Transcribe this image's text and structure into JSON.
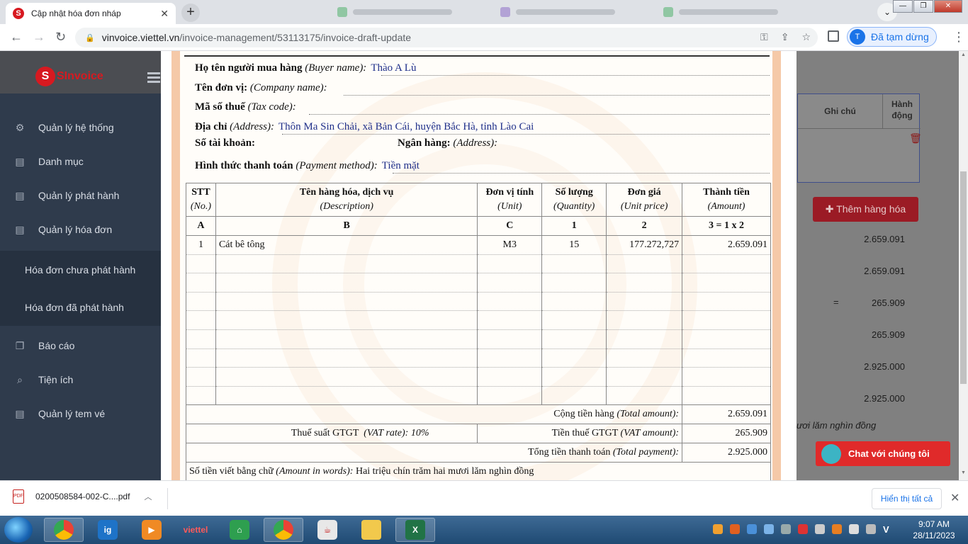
{
  "browser": {
    "tab_title": "Cập nhật hóa đơn nháp",
    "url_host": "vinvoice.viettel.vn",
    "url_path": "/invoice-management/53113175/invoice-draft-update",
    "profile_initial": "T",
    "profile_label": "Đã tạm dừng"
  },
  "sidebar": {
    "logo": "SInvoice",
    "items": [
      {
        "label": "Quản lý hệ thống",
        "icon": "gear-icon"
      },
      {
        "label": "Danh mục",
        "icon": "list-icon"
      },
      {
        "label": "Quản lý phát hành",
        "icon": "list-icon"
      },
      {
        "label": "Quản lý hóa đơn",
        "icon": "list-icon"
      },
      {
        "label": "Hóa đơn chưa phát hành",
        "icon": ""
      },
      {
        "label": "Hóa đơn đã phát hành",
        "icon": ""
      },
      {
        "label": "Báo cáo",
        "icon": "copy-icon"
      },
      {
        "label": "Tiện ích",
        "icon": "search-icon"
      },
      {
        "label": "Quản lý tem vé",
        "icon": "list-icon"
      }
    ]
  },
  "invoice": {
    "buyer_name_label": "Họ tên người mua hàng",
    "buyer_name_en": "(Buyer name):",
    "buyer_name": "Thào A Lù",
    "company_label": "Tên đơn vị:",
    "company_en": "(Company name):",
    "tax_label": "Mã số thuế",
    "tax_en": "(Tax code):",
    "address_label": "Địa chỉ",
    "address_en": "(Address):",
    "address": "Thôn Ma Sin Chải, xã Bản Cái, huyện Bắc Hà, tỉnh Lào Cai",
    "account_label": "Số tài khoản:",
    "bank_label": "Ngân hàng:",
    "bank_en": "(Address):",
    "payment_label": "Hình thức thanh toán",
    "payment_en": "(Payment method):",
    "payment": "Tiền mặt",
    "table_headers": [
      {
        "vi": "STT",
        "en": "(No.)",
        "code": "A"
      },
      {
        "vi": "Tên hàng hóa, dịch vụ",
        "en": "(Description)",
        "code": "B"
      },
      {
        "vi": "Đơn vị tính",
        "en": "(Unit)",
        "code": "C"
      },
      {
        "vi": "Số lượng",
        "en": "(Quantity)",
        "code": "1"
      },
      {
        "vi": "Đơn giá",
        "en": "(Unit price)",
        "code": "2"
      },
      {
        "vi": "Thành tiền",
        "en": "(Amount)",
        "code": "3 = 1 x 2"
      }
    ],
    "rows": [
      {
        "no": "1",
        "desc": "Cát bê tông",
        "unit": "M3",
        "qty": "15",
        "price": "177.272,727",
        "amount": "2.659.091"
      },
      {
        "no": "",
        "desc": "",
        "unit": "",
        "qty": "",
        "price": "",
        "amount": ""
      },
      {
        "no": "",
        "desc": "",
        "unit": "",
        "qty": "",
        "price": "",
        "amount": ""
      },
      {
        "no": "",
        "desc": "",
        "unit": "",
        "qty": "",
        "price": "",
        "amount": ""
      },
      {
        "no": "",
        "desc": "",
        "unit": "",
        "qty": "",
        "price": "",
        "amount": ""
      },
      {
        "no": "",
        "desc": "",
        "unit": "",
        "qty": "",
        "price": "",
        "amount": ""
      },
      {
        "no": "",
        "desc": "",
        "unit": "",
        "qty": "",
        "price": "",
        "amount": ""
      },
      {
        "no": "",
        "desc": "",
        "unit": "",
        "qty": "",
        "price": "",
        "amount": ""
      },
      {
        "no": "",
        "desc": "",
        "unit": "",
        "qty": "",
        "price": "",
        "amount": ""
      }
    ],
    "total_label": "Cộng tiền hàng",
    "total_en": "(Total amount):",
    "total": "2.659.091",
    "vat_rate_label": "Thuế suất GTGT",
    "vat_rate_en": "(VAT rate):",
    "vat_rate": "10%",
    "vat_amount_label": "Tiền thuế GTGT",
    "vat_amount_en": "(VAT amount):",
    "vat_amount": "265.909",
    "payment_total_label": "Tổng tiền thanh toán",
    "payment_total_en": "(Total payment):",
    "payment_total": "2.925.000",
    "words_label": "Số tiền viết bằng chữ",
    "words_en": "(Amount in words):",
    "words": "Hai triệu chín trăm hai mươi lăm nghìn đồng"
  },
  "background_form": {
    "col_note": "Ghi chú",
    "col_action": "Hành động",
    "add_button": "Thêm hàng hóa",
    "values": [
      "2.659.091",
      "2.659.091",
      "265.909",
      "265.909",
      "2.925.000",
      "2.925.000"
    ],
    "equals": "=",
    "words_partial": "ươi lăm nghìn đồng",
    "chat_button": "Chat với chúng tôi"
  },
  "download_bar": {
    "file_name": "0200508584-002-C....pdf",
    "show_all": "Hiển thị tất cả"
  },
  "taskbar": {
    "viettel_label": "viettel",
    "time": "9:07 AM",
    "date": "28/11/2023",
    "lang": "V"
  }
}
